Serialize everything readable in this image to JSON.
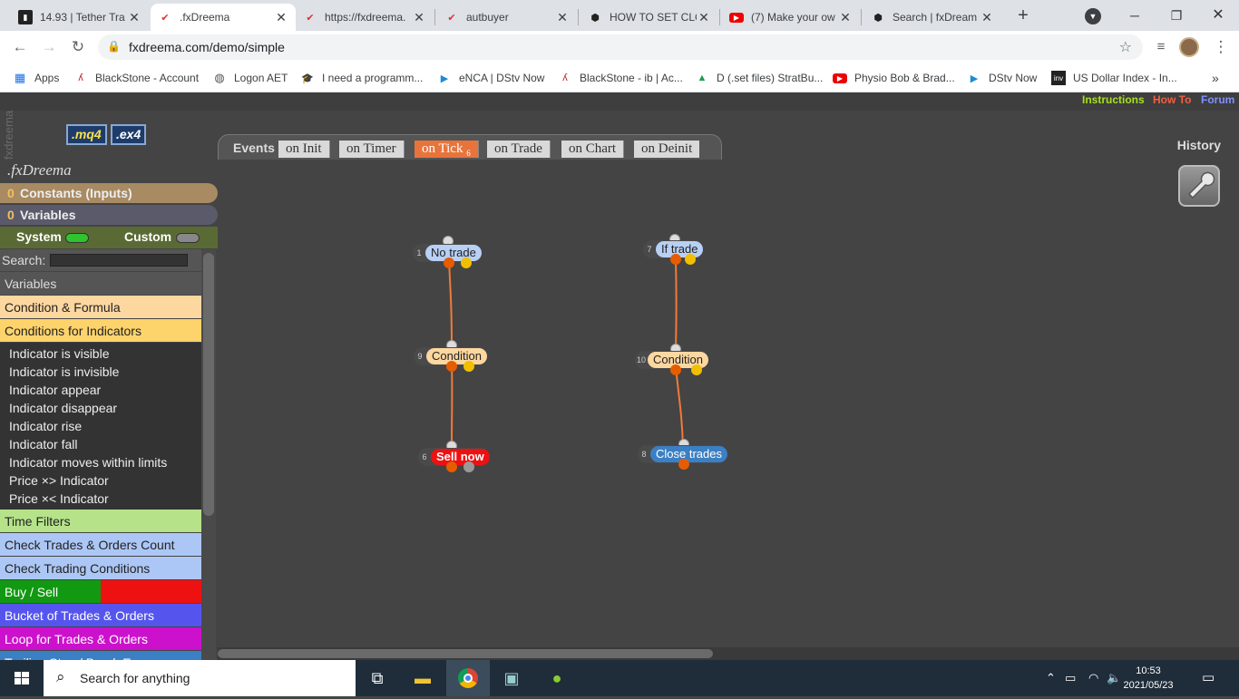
{
  "browser": {
    "tabs": [
      {
        "title": "14.93 | Tether Tra",
        "icon": "tether-chart-icon",
        "active": false
      },
      {
        "title": ".fxDreema",
        "icon": "fxdreema-icon",
        "active": true
      },
      {
        "title": "https://fxdreema.",
        "icon": "fxdreema-icon",
        "active": false
      },
      {
        "title": "autbuyer",
        "icon": "fxdreema-icon",
        "active": false
      },
      {
        "title": "HOW TO SET CLO",
        "icon": "github-icon",
        "active": false
      },
      {
        "title": "(7) Make your ow",
        "icon": "youtube-icon",
        "active": false
      },
      {
        "title": "Search | fxDream",
        "icon": "github-icon",
        "active": false
      }
    ],
    "new_tab": "+",
    "url": "fxdreema.com/demo/simple",
    "bookmarks": [
      {
        "label": "Apps",
        "icon": "apps-grid-icon"
      },
      {
        "label": "BlackStone - Account",
        "icon": "blackstone-icon"
      },
      {
        "label": "Logon AET",
        "icon": "globe-icon"
      },
      {
        "label": "I need a programm...",
        "icon": "graduation-cap-icon"
      },
      {
        "label": "eNCA | DStv Now",
        "icon": "dstv-play-icon"
      },
      {
        "label": "BlackStone - ib | Ac...",
        "icon": "blackstone-icon"
      },
      {
        "label": "D (.set files) StratBu...",
        "icon": "google-drive-icon"
      },
      {
        "label": "Physio Bob & Brad...",
        "icon": "youtube-icon"
      },
      {
        "label": "DStv Now",
        "icon": "dstv-play-icon"
      },
      {
        "label": "US Dollar Index - In...",
        "icon": "investing-icon"
      }
    ],
    "more_bookmarks": "»"
  },
  "app": {
    "top_links": [
      {
        "label": "Instructions",
        "color": "#a8e020"
      },
      {
        "label": "How To",
        "color": "#f06040"
      },
      {
        "label": "Forum",
        "color": "#8090ff"
      }
    ],
    "watermark": "fxdreema",
    "file_buttons": [
      ".mq4",
      ".ex4"
    ],
    "brand": ".fxDreema",
    "events_label": "Events",
    "event_tabs": [
      {
        "label": "on Init",
        "active": false
      },
      {
        "label": "on Timer",
        "active": false
      },
      {
        "label": "on Tick",
        "badge": "6",
        "active": true
      },
      {
        "label": "on Trade",
        "active": false
      },
      {
        "label": "on Chart",
        "active": false
      },
      {
        "label": "on Deinit",
        "active": false
      }
    ],
    "history_label": "History",
    "sidebar": {
      "constants": {
        "count": "0",
        "label": "Constants (Inputs)"
      },
      "variables": {
        "count": "0",
        "label": "Variables"
      },
      "system_label": "System",
      "custom_label": "Custom",
      "search_label": "Search:",
      "categories": [
        {
          "label": "Variables",
          "bg": "#555555",
          "fg": "#dddddd"
        },
        {
          "label": "Condition & Formula",
          "bg": "#fdd7a0",
          "fg": "#222222"
        },
        {
          "label": "Conditions for Indicators",
          "bg": "#fdd36b",
          "fg": "#222222",
          "items": [
            "Indicator is visible",
            "Indicator is invisible",
            "Indicator appear",
            "Indicator disappear",
            "Indicator rise",
            "Indicator fall",
            "Indicator moves within limits",
            "Price ×> Indicator",
            "Price ×< Indicator"
          ]
        },
        {
          "label": "Time Filters",
          "bg": "#b6e38a",
          "fg": "#222222"
        },
        {
          "label": "Check Trades & Orders Count",
          "bg": "#acc7f5",
          "fg": "#222222"
        },
        {
          "label": "Check Trading Conditions",
          "bg": "#acc7f5",
          "fg": "#222222"
        },
        {
          "label": "Buy / Sell",
          "bg": "linear-gradient(90deg,#119911 50%,#ee1111 50%)",
          "fg": "#ffffff"
        },
        {
          "label": "Bucket of Trades & Orders",
          "bg": "#5555ee",
          "fg": "#ffffff"
        },
        {
          "label": "Loop for Trades & Orders",
          "bg": "#cc11cc",
          "fg": "#ffffff"
        },
        {
          "label": "Trailing Stop / Break Even",
          "bg": "#3b7fc4",
          "fg": "#ffffff"
        }
      ]
    },
    "blocks": [
      {
        "id": "1",
        "label": "No trade",
        "bg": "#b8d0f5",
        "fg": "#222222"
      },
      {
        "id": "9",
        "label": "Condition",
        "bg": "#fdd7a0",
        "fg": "#222222"
      },
      {
        "id": "6",
        "label": "Sell now",
        "bg": "#ee1111",
        "fg": "#ffffff"
      },
      {
        "id": "7",
        "label": "If trade",
        "bg": "#b8d0f5",
        "fg": "#222222"
      },
      {
        "id": "10",
        "label": "Condition",
        "bg": "#fdd7a0",
        "fg": "#222222"
      },
      {
        "id": "8",
        "label": "Close trades",
        "bg": "#3b7fc4",
        "fg": "#ffffff"
      }
    ]
  },
  "taskbar": {
    "search_placeholder": "Search for anything",
    "time": "10:53",
    "date": "2021/05/23"
  }
}
